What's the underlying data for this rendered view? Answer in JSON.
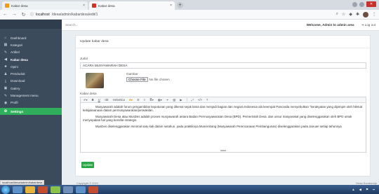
{
  "browser": {
    "tabs": [
      {
        "label": "Kabar desa"
      },
      {
        "label": "Kabar desa"
      }
    ],
    "new_tab": "+",
    "url_host": "localhost",
    "url_path": "/desa/admin/kabardesa/edit/1"
  },
  "sidebar": {
    "brand": "",
    "items": [
      {
        "label": "Dashboard",
        "icon": "home-icon"
      },
      {
        "label": "Kategori",
        "icon": "grid-icon"
      },
      {
        "label": "Artikel",
        "icon": "pencil-icon"
      },
      {
        "label": "Kabar desa",
        "icon": "megaphone-icon"
      },
      {
        "label": "Opini",
        "icon": "thumbs-up-icon"
      },
      {
        "label": "Penduduk",
        "icon": "person-icon"
      },
      {
        "label": "Download",
        "icon": "download-icon"
      },
      {
        "label": "Galery",
        "icon": "gallery-icon"
      },
      {
        "label": "Management menu",
        "icon": "pencil-icon"
      },
      {
        "label": "Profil",
        "icon": "user-circle-icon"
      },
      {
        "label": "Settings",
        "icon": "gear-icon"
      }
    ]
  },
  "header": {
    "search_placeholder": "Search...",
    "welcome": "Welcome, Admin to admin area",
    "logout": "Log out"
  },
  "form": {
    "title": "Update kabar desa",
    "judul_label": "Judul",
    "judul_value": "ACARA MUSYAWARAH DESA",
    "gambar_label": "Gambar",
    "choose_file": "Choose File",
    "no_file": "No file chosen",
    "kabar_label": "Kabar desa",
    "toolbar_format": "Helvetica",
    "paragraphs": [
      "Musyawarah adalah forum pengambilan keputusan yang dikenal sejak lama dan menjadi bagian dan negara Indonesia ala keempat Pancasila menyebutkan \"kerakyatan yang dipimpin oleh hikmat kebijaksanaan dalam permusyawaratan/perwakilan.",
      "Musyawarah Desa atau MusDes adalah proses musyawarah antara Badan Permusyawaratan Desa (BPD). Pemerintah Desa. dan unsur masyarakat yang diselenggarakan oleh BPD untuk menyepakati hal yang bersifat strategis.",
      "MusDes diselenggarakan minimal satu kali dalam setahun. pada praktiknya Musrenbang (Musyawarah Perencanaan Pembangunan) diselenggarakan pada Januari setiap tahunnya"
    ],
    "submit": "Update"
  },
  "footer": {
    "copyright": "Copyright © 2021",
    "right": "Desa Sumberejo"
  },
  "status_url": "localhost/desa/admin/kabardesa",
  "colors": {
    "sidebar": "#3c4b5c",
    "settings_active": "#2fae5c",
    "submit": "#28a745"
  }
}
